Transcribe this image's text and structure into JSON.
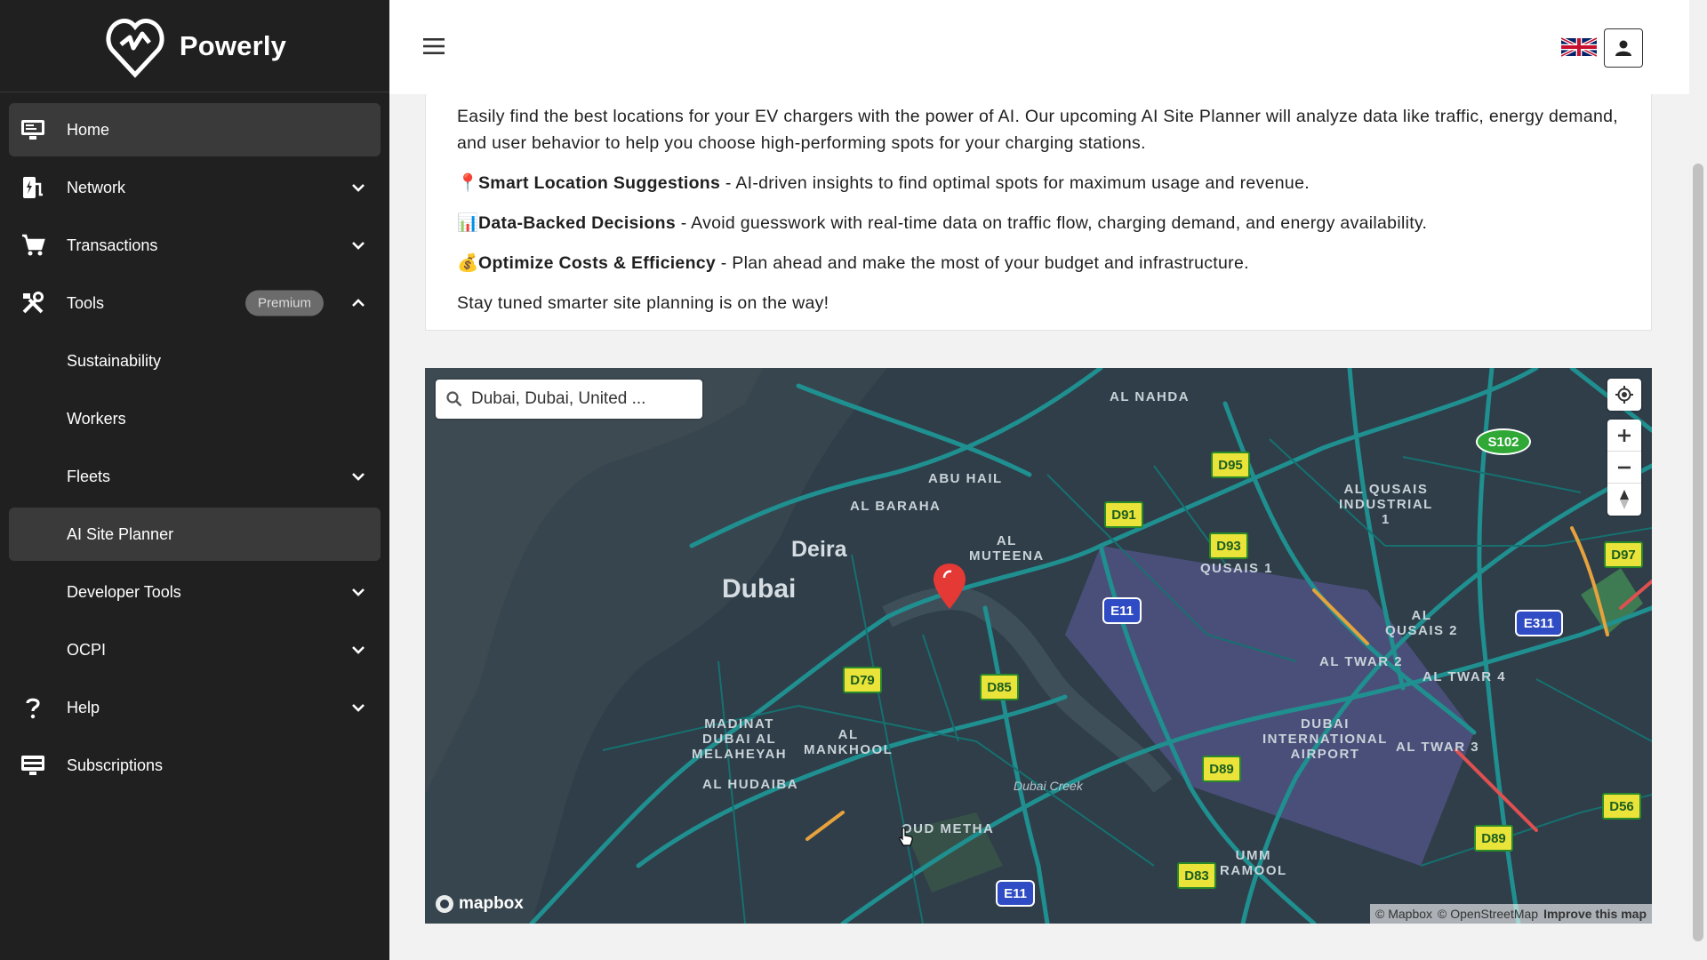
{
  "brand": {
    "name": "Powerly"
  },
  "sidebar": {
    "items": [
      {
        "label": "Home",
        "icon": "monitor-icon",
        "active": true
      },
      {
        "label": "Network",
        "icon": "charging-station-icon"
      },
      {
        "label": "Transactions",
        "icon": "cart-icon"
      },
      {
        "label": "Tools",
        "icon": "tools-icon",
        "badge": "Premium"
      },
      {
        "label": "Sustainability"
      },
      {
        "label": "Workers"
      },
      {
        "label": "Fleets"
      },
      {
        "label": "AI Site Planner",
        "active": true
      },
      {
        "label": "Developer Tools"
      },
      {
        "label": "OCPI"
      },
      {
        "label": "Help",
        "icon": "help-icon"
      },
      {
        "label": "Subscriptions",
        "icon": "subscriptions-icon"
      }
    ]
  },
  "card": {
    "intro": "Easily find the best locations for your EV chargers with the power of AI. Our upcoming AI Site Planner will analyze data like traffic, energy demand, and user behavior to help you choose high-performing spots for your charging stations.",
    "features": [
      {
        "emoji": "📍",
        "title": "Smart Location Suggestions",
        "text": " - AI-driven insights to find optimal spots for maximum usage and revenue."
      },
      {
        "emoji": "📊",
        "title": "Data-Backed Decisions",
        "text": " - Avoid guesswork with real-time data on traffic flow, charging demand, and energy availability."
      },
      {
        "emoji": "💰",
        "title": "Optimize Costs & Efficiency",
        "text": " - Plan ahead and make the most of your budget and infrastructure."
      }
    ],
    "outro": "Stay tuned smarter site planning is on the way!"
  },
  "map": {
    "search_value": "Dubai, Dubai, United ...",
    "attribution": {
      "mapbox": "© Mapbox",
      "osm": "© OpenStreetMap",
      "improve": "Improve this map"
    },
    "logo_text": "mapbox",
    "labels": {
      "dubai": "Dubai",
      "deira": "Deira",
      "al_nahda": "AL NAHDA",
      "abu_hail": "ABU HAIL",
      "al_baraha": "AL BARAHA",
      "al_muteena": "AL\nMUTEENA",
      "al_qusais_industrial": "AL QUSAIS\nINDUSTRIAL\n1",
      "al_qusais_1": "AL\nQUSAIS 1",
      "al_qusais_2": "AL\nQUSAIS 2",
      "al_twar_2": "AL TWAR 2",
      "al_twar_4": "AL TWAR 4",
      "al_twar_3": "AL TWAR 3",
      "dubai_airport": "DUBAI\nINTERNATIONAL\nAIRPORT",
      "madinat": "MADINAT\nDUBAI AL\nMELAHEYAH",
      "al_mankhool": "AL\nMANKHOOL",
      "al_hudaiba": "AL HUDAIBA",
      "oud_metha": "OUD METHA",
      "umm_ramool": "UMM\nRAMOOL",
      "dubai_creek": "Dubai Creek"
    },
    "shields": {
      "d95": "D95",
      "d91": "D91",
      "d93": "D93",
      "d97": "D97",
      "s102": "S102",
      "e11a": "E11",
      "e311": "E311",
      "d79": "D79",
      "d85": "D85",
      "d89a": "D89",
      "d89b": "D89",
      "d56": "D56",
      "d83": "D83",
      "e11b": "E11"
    }
  },
  "colors": {
    "sidebar_bg": "#202020",
    "map_bg": "#2b3a44",
    "road": "#1f8f8f",
    "marker": "#e53935"
  }
}
